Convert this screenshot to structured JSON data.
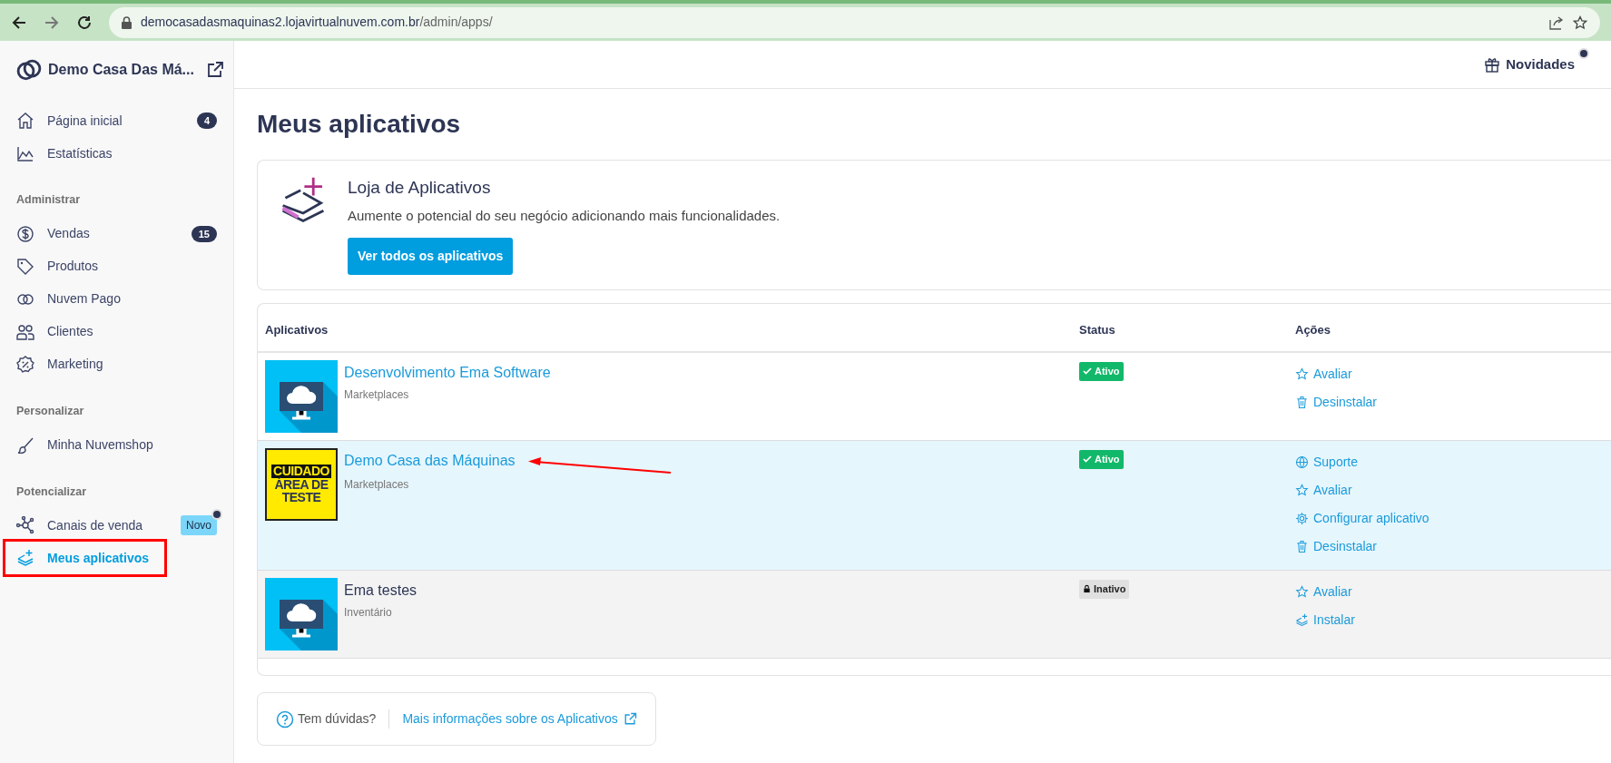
{
  "browser": {
    "url_host": "democasadasmaquinas2.lojavirtualnuvem.com.br",
    "url_path": "/admin/apps/"
  },
  "sidebar": {
    "store_name": "Demo Casa Das Má...",
    "sections": [
      {
        "items": [
          {
            "label": "Página inicial",
            "kind": "home",
            "badge": "4",
            "selected": false,
            "highlighted": false
          },
          {
            "label": "Estatísticas",
            "kind": "chart",
            "selected": false,
            "highlighted": false
          }
        ]
      },
      {
        "title": "Administrar",
        "items": [
          {
            "label": "Vendas",
            "kind": "dollar",
            "badge": "15",
            "selected": false,
            "highlighted": false
          },
          {
            "label": "Produtos",
            "kind": "tag",
            "selected": false,
            "highlighted": false
          },
          {
            "label": "Nuvem Pago",
            "kind": "rings",
            "selected": false,
            "highlighted": false
          },
          {
            "label": "Clientes",
            "kind": "users",
            "selected": false,
            "highlighted": false
          },
          {
            "label": "Marketing",
            "kind": "percent",
            "selected": false,
            "highlighted": false
          }
        ]
      },
      {
        "title": "Personalizar",
        "items": [
          {
            "label": "Minha Nuvemshop",
            "kind": "brush",
            "selected": false,
            "highlighted": false
          }
        ]
      },
      {
        "title": "Potencializar",
        "items": [
          {
            "label": "Canais de venda",
            "kind": "nodes",
            "tag": "Novo",
            "selected": false,
            "highlighted": false
          },
          {
            "label": "Meus aplicativos",
            "kind": "apps",
            "selected": true,
            "highlighted": true
          }
        ]
      }
    ]
  },
  "header": {
    "news": "Novidades"
  },
  "page_title": "Meus aplicativos",
  "store_card": {
    "title": "Loja de Aplicativos",
    "text": "Aumente o potencial do seu negócio adicionando mais funcionalidades.",
    "button": "Ver todos os aplicativos"
  },
  "table": {
    "columns": [
      "Aplicativos",
      "Status",
      "Ações"
    ],
    "rows": [
      {
        "name": "Desenvolvimento Ema Software",
        "category": "Marketplaces",
        "thumbnail": {
          "kind": "monitor"
        },
        "active": true,
        "status": "Ativo",
        "selected": false,
        "pointed": false,
        "actions": [
          {
            "kind": "star",
            "label": "Avaliar"
          },
          {
            "kind": "trash",
            "label": "Desinstalar"
          }
        ]
      },
      {
        "name": "Demo Casa das Máquinas",
        "category": "Marketplaces",
        "thumbnail": {
          "kind": "sign",
          "lines": [
            "CUIDADO",
            "ÁREA DE",
            "TESTE"
          ]
        },
        "active": true,
        "status": "Ativo",
        "selected": true,
        "pointed": true,
        "actions": [
          {
            "kind": "globe",
            "label": "Suporte"
          },
          {
            "kind": "star",
            "label": "Avaliar"
          },
          {
            "kind": "gear",
            "label": "Configurar aplicativo"
          },
          {
            "kind": "trash",
            "label": "Desinstalar"
          }
        ]
      },
      {
        "name": "Ema testes",
        "category": "Inventário",
        "thumbnail": {
          "kind": "monitor"
        },
        "active": false,
        "status": "Inativo",
        "selected": false,
        "pointed": false,
        "actions": [
          {
            "kind": "star",
            "label": "Avaliar"
          },
          {
            "kind": "install",
            "label": "Instalar"
          }
        ]
      }
    ]
  },
  "help": {
    "question": "Tem dúvidas?",
    "link": "Mais informações sobre os Aplicativos"
  }
}
